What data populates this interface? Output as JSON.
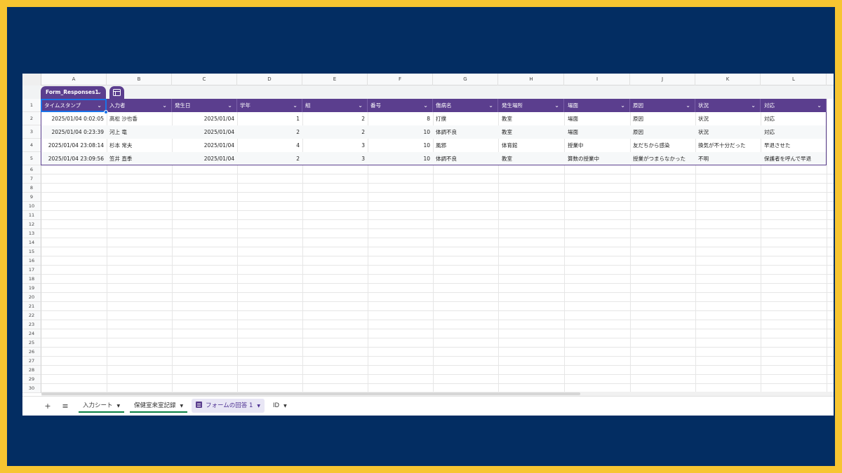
{
  "columns": [
    "A",
    "B",
    "C",
    "D",
    "E",
    "F",
    "G",
    "H",
    "I",
    "J",
    "K",
    "L"
  ],
  "table_name": "Form_Responses1",
  "headers": [
    "タイムスタンプ",
    "入力者",
    "発生日",
    "学年",
    "組",
    "番号",
    "傷病名",
    "発生場所",
    "場面",
    "原因",
    "状況",
    "対応"
  ],
  "rows": [
    [
      "2025/01/04 0:02:05",
      "高松 沙也香",
      "2025/01/04",
      "1",
      "2",
      "8",
      "打撲",
      "教室",
      "場面",
      "原因",
      "状況",
      "対応"
    ],
    [
      "2025/01/04 0:23:39",
      "河上 竜",
      "2025/01/04",
      "2",
      "2",
      "10",
      "体調不良",
      "教室",
      "場面",
      "原因",
      "状況",
      "対応"
    ],
    [
      "2025/01/04 23:08:14",
      "杉本 常夫",
      "2025/01/04",
      "4",
      "3",
      "10",
      "風邪",
      "体育館",
      "授業中",
      "友だちから感染",
      "換気が不十分だった",
      "早退させた"
    ],
    [
      "2025/01/04 23:09:56",
      "笠井 直季",
      "2025/01/04",
      "2",
      "3",
      "10",
      "体調不良",
      "教室",
      "算数の授業中",
      "授業がつまらなかった",
      "不明",
      "保護者を呼んで早退"
    ]
  ],
  "row_numbers": [
    "1",
    "2",
    "3",
    "4",
    "5",
    "6",
    "7",
    "8",
    "9",
    "10",
    "11",
    "12",
    "13",
    "14",
    "15",
    "16",
    "17",
    "18",
    "19",
    "20",
    "21",
    "22",
    "23",
    "24",
    "25",
    "26",
    "27",
    "28",
    "29",
    "30"
  ],
  "tabs": [
    {
      "label": "入力シート",
      "style": "under"
    },
    {
      "label": "保健室来室記録",
      "style": "under"
    },
    {
      "label": "フォームの回答 1",
      "style": "active"
    },
    {
      "label": "ID",
      "style": "plain"
    }
  ],
  "toolbar": {
    "add_sheet": "+",
    "all_sheets": "≡"
  },
  "colors": {
    "frame_border": "#f7c531",
    "frame_bg": "#032d62",
    "table_header": "#5b3e8e",
    "selection": "#1a73e8"
  }
}
